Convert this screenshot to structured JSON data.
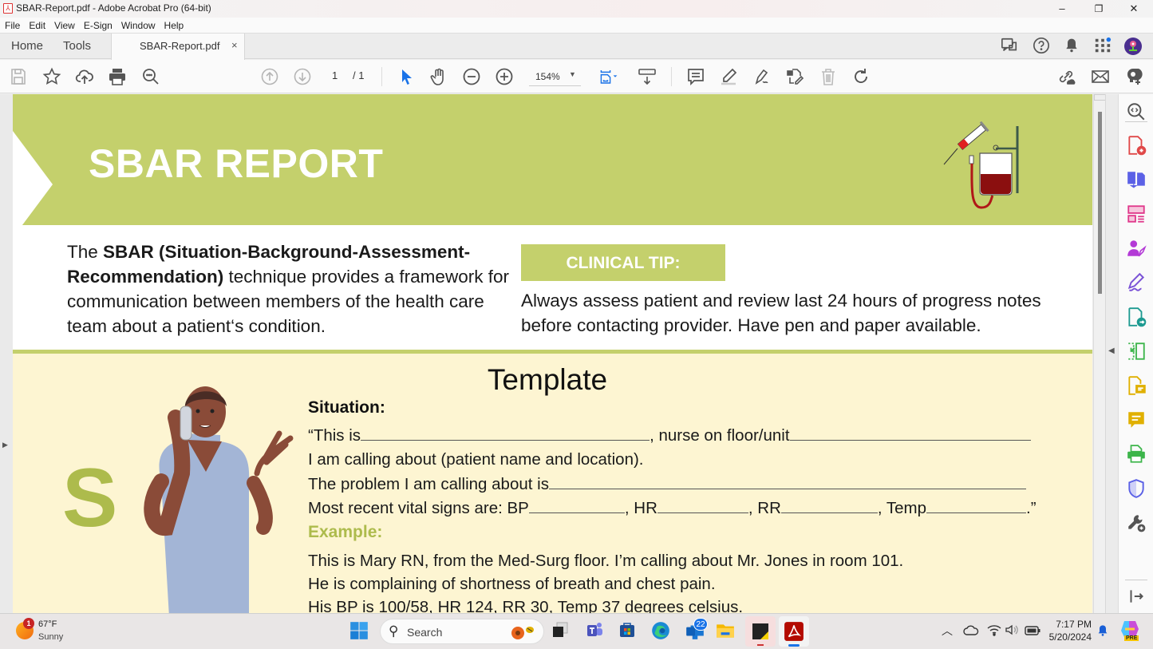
{
  "window": {
    "title": "SBAR-Report.pdf - Adobe Acrobat Pro (64-bit)",
    "minimize": "–",
    "maximize": "❐",
    "close": "✕"
  },
  "menu": [
    "File",
    "Edit",
    "View",
    "E-Sign",
    "Window",
    "Help"
  ],
  "tabs": {
    "home": "Home",
    "tools": "Tools",
    "document": "SBAR-Report.pdf",
    "close": "×"
  },
  "toolbar": {
    "page_current": "1",
    "page_total": "/ 1",
    "zoom": "154%"
  },
  "document": {
    "banner_title": "SBAR REPORT",
    "intro_prefix": "The ",
    "intro_bold": "SBAR (Situation-Background-Assessment-Recommendation)",
    "intro_rest": " technique provides a framework for communication between members of the health care team about a patient‘s condition.",
    "tip_label": "CLINICAL TIP:",
    "tip_text": "Always assess patient and review last 24 hours of progress notes before contacting provider. Have pen and paper available.",
    "section_letter": "S",
    "template_title": "Template",
    "situation_label": "Situation:",
    "line1_a": "“This is",
    "line1_b": ", nurse on floor/unit",
    "line2": "I am calling about (patient name and location).",
    "line3": "The problem I am calling about is",
    "vitals_prefix": "Most recent vital signs are:  BP",
    "vitals_hr": ", HR",
    "vitals_rr": ", RR",
    "vitals_temp": ", Temp",
    "vitals_end": ".”",
    "example_label": "Example:",
    "example_lines": [
      "This is Mary RN, from the Med-Surg floor. I’m calling about Mr. Jones in room 101.",
      "He is complaining of shortness of breath and chest pain.",
      "His BP is 100/58, HR 124, RR 30, Temp 37 degrees celsius."
    ]
  },
  "colors": {
    "brand_green": "#c4d06c",
    "letter_green": "#adbb4c",
    "template_bg": "#fdf5d2",
    "acrobat_red": "#d32f2f",
    "select_blue": "#1a73e8"
  },
  "taskbar": {
    "weather_temp": "67°F",
    "weather_desc": "Sunny",
    "weather_badge": "1",
    "search_placeholder": "Search",
    "outlook_badge": "22",
    "time": "7:17 PM",
    "date": "5/20/2024",
    "copilot_tag": "PRE"
  }
}
